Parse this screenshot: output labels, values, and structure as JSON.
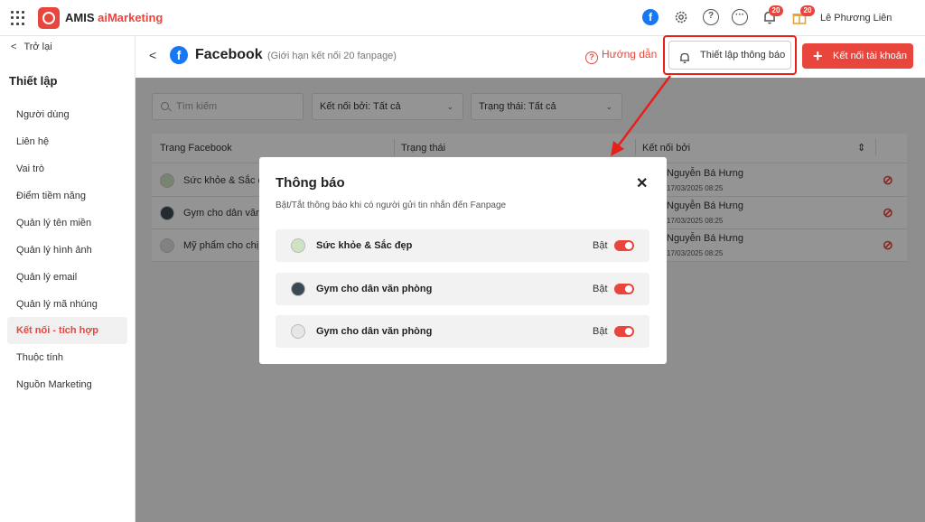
{
  "app": {
    "name_part1": "AMIS ",
    "name_part2": "aiMarketing",
    "brand_color": "#e8453c"
  },
  "topbar": {
    "fb_glyph": "f",
    "settings_icon": "gear-icon",
    "help_glyph": "?",
    "chat_glyph": "···",
    "notif_count": "20",
    "gift_count": "20",
    "user_name": "Lê Phương Liên"
  },
  "sidebar": {
    "back_label": "Trở lại",
    "title": "Thiết lập",
    "items": [
      {
        "label": "Người dùng"
      },
      {
        "label": "Liên hệ"
      },
      {
        "label": "Vai trò"
      },
      {
        "label": "Điểm tiềm năng"
      },
      {
        "label": "Quản lý tên miền"
      },
      {
        "label": "Quản lý hình ảnh"
      },
      {
        "label": "Quản lý email"
      },
      {
        "label": "Quản lý mã nhúng"
      },
      {
        "label": "Kết nối - tích hợp"
      },
      {
        "label": "Thuộc tính"
      },
      {
        "label": "Nguồn Marketing"
      }
    ],
    "active_index": 8
  },
  "header": {
    "fb_glyph": "f",
    "title": "Facebook",
    "subtitle": "(Giới hạn kết nối 20 fanpage)",
    "guide_label": "Hướng dẫn",
    "guide_glyph": "?",
    "notif_settings_label": "Thiết lập thông báo",
    "connect_label": "Kết nối tài khoản",
    "plus_glyph": "+"
  },
  "filters": {
    "search_placeholder": "Tìm kiếm",
    "connected_by": "Kết nối bởi: Tất cả",
    "status": "Trạng thái: Tất cả",
    "chevron": "⌄"
  },
  "table": {
    "columns": [
      "Trang Facebook",
      "Trạng thái",
      "Kết nối bởi"
    ],
    "sort_glyph": "⇕",
    "unlink_glyph": "⊘",
    "rows": [
      {
        "page": "Sức khỏe & Sắc đẹp",
        "connected_by": "Nguyễn Bá Hưng",
        "date": "17/03/2025 08:25"
      },
      {
        "page": "Gym cho dân văn phòng",
        "connected_by": "Nguyễn Bá Hưng",
        "date": "17/03/2025 08:25"
      },
      {
        "page": "Mỹ phẩm cho chị em",
        "connected_by": "Nguyễn Bá Hưng",
        "date": "17/03/2025 08:25"
      }
    ]
  },
  "modal": {
    "title": "Thông báo",
    "close_glyph": "✕",
    "description": "Bật/Tắt thông báo khi có người gửi tin nhắn đến Fanpage",
    "items": [
      {
        "name": "Sức khỏe & Sắc đẹp",
        "state": "Bật",
        "on": true
      },
      {
        "name": "Gym cho dân văn phòng",
        "state": "Bật",
        "on": true
      },
      {
        "name": "Gym cho dân văn phòng",
        "state": "Bật",
        "on": true
      }
    ]
  }
}
